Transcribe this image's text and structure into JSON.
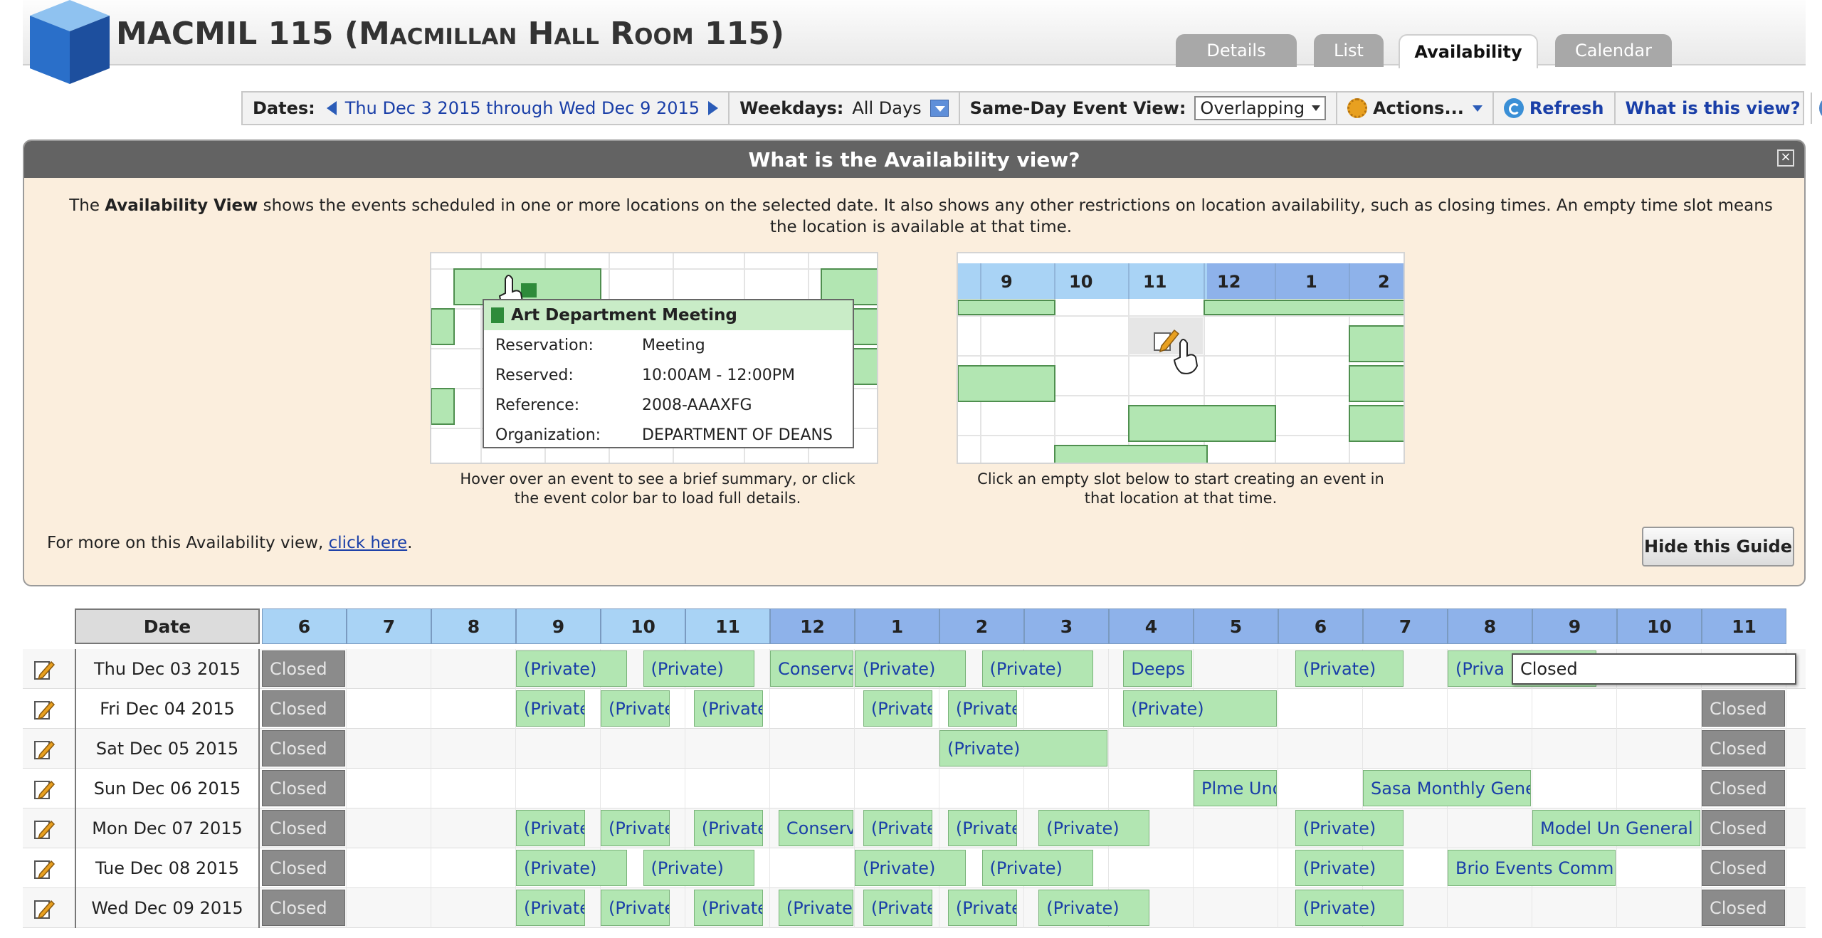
{
  "header": {
    "room_code": "MACMIL 115",
    "room_name": "(Macmillan Hall Room 115)",
    "tabs": [
      {
        "label": "Details",
        "active": false
      },
      {
        "label": "List",
        "active": false
      },
      {
        "label": "Availability",
        "active": true
      },
      {
        "label": "Calendar",
        "active": false
      }
    ]
  },
  "toolbar": {
    "dates_label": "Dates:",
    "date_range": "Thu Dec 3 2015 through Wed Dec 9 2015",
    "weekdays_label": "Weekdays:",
    "weekdays_value": "All Days",
    "same_day_label": "Same-Day Event View:",
    "same_day_value": "Overlapping",
    "actions_label": "Actions...",
    "refresh_label": "Refresh",
    "what_is_label": "What is this view?",
    "help_glyph": "?"
  },
  "guide": {
    "title": "What is the Availability view?",
    "close_glyph": "×",
    "intro_pre": "The ",
    "intro_bold": "Availability View",
    "intro_post": " shows the events scheduled in one or more locations on the selected date. It also shows any other restrictions on location availability, such as closing times. An empty time slot means the location is available at that time.",
    "example1": {
      "popup_title": "Art Department Meeting",
      "rows": [
        {
          "key": "Reservation:",
          "value": "Meeting"
        },
        {
          "key": "Reserved:",
          "value": "10:00AM - 12:00PM"
        },
        {
          "key": "Reference:",
          "value": "2008-AAAXFG"
        },
        {
          "key": "Organization:",
          "value": "DEPARTMENT OF DEANS"
        }
      ],
      "caption": "Hover over an event to see a brief summary, or click the event color bar to load full details."
    },
    "example2": {
      "hours": [
        "9",
        "10",
        "11",
        "12",
        "1",
        "2"
      ],
      "caption": "Click an empty slot below to start creating an event in that location at that time."
    },
    "more_pre": "For more on this Availability view, ",
    "more_link": "click here",
    "more_post": ".",
    "hide_button": "Hide this Guide"
  },
  "grid": {
    "date_header": "Date",
    "hours": [
      "6",
      "7",
      "8",
      "9",
      "10",
      "11",
      "12",
      "1",
      "2",
      "3",
      "4",
      "5",
      "6",
      "7",
      "8",
      "9",
      "10",
      "11"
    ],
    "pm_start_index": 6,
    "rows": [
      {
        "date": "Thu Dec 03 2015",
        "events": [
          {
            "label": "Closed",
            "type": "closed",
            "start": 6,
            "end": 7
          },
          {
            "label": "(Private)",
            "type": "event",
            "start": 9,
            "end": 10.33
          },
          {
            "label": "(Private)",
            "type": "event",
            "start": 10.5,
            "end": 11.83
          },
          {
            "label": "Conservat",
            "type": "event",
            "start": 12,
            "end": 13
          },
          {
            "label": "(Private)",
            "type": "event",
            "start": 13,
            "end": 14.33
          },
          {
            "label": "(Private)",
            "type": "event",
            "start": 14.5,
            "end": 15.83
          },
          {
            "label": "Deeps C",
            "type": "event",
            "start": 16.17,
            "end": 17
          },
          {
            "label": "(Private)",
            "type": "event",
            "start": 18.2,
            "end": 19.5
          },
          {
            "label": "(Priva",
            "type": "event",
            "start": 20,
            "end": 21.77
          }
        ]
      },
      {
        "date": "Fri Dec 04 2015",
        "events": [
          {
            "label": "Closed",
            "type": "closed",
            "start": 6,
            "end": 7
          },
          {
            "label": "(Private",
            "type": "event",
            "start": 9,
            "end": 9.83
          },
          {
            "label": "(Private",
            "type": "event",
            "start": 10,
            "end": 10.83
          },
          {
            "label": "(Private",
            "type": "event",
            "start": 11.1,
            "end": 11.93
          },
          {
            "label": "(Private",
            "type": "event",
            "start": 13.1,
            "end": 13.93
          },
          {
            "label": "(Private",
            "type": "event",
            "start": 14.1,
            "end": 14.93
          },
          {
            "label": "(Private)",
            "type": "event",
            "start": 16.17,
            "end": 18
          },
          {
            "label": "Closed",
            "type": "closed",
            "start": 23,
            "end": 24
          }
        ]
      },
      {
        "date": "Sat Dec 05 2015",
        "events": [
          {
            "label": "Closed",
            "type": "closed",
            "start": 6,
            "end": 7
          },
          {
            "label": "(Private)",
            "type": "event",
            "start": 14,
            "end": 16
          },
          {
            "label": "Closed",
            "type": "closed",
            "start": 23,
            "end": 24
          }
        ]
      },
      {
        "date": "Sun Dec 06 2015",
        "events": [
          {
            "label": "Closed",
            "type": "closed",
            "start": 6,
            "end": 7
          },
          {
            "label": "Plme Und",
            "type": "event",
            "start": 17,
            "end": 18
          },
          {
            "label": "Sasa Monthly Genera",
            "type": "event",
            "start": 19,
            "end": 21
          },
          {
            "label": "Closed",
            "type": "closed",
            "start": 23,
            "end": 24
          }
        ]
      },
      {
        "date": "Mon Dec 07 2015",
        "events": [
          {
            "label": "Closed",
            "type": "closed",
            "start": 6,
            "end": 7
          },
          {
            "label": "(Private",
            "type": "event",
            "start": 9,
            "end": 9.83
          },
          {
            "label": "(Private",
            "type": "event",
            "start": 10,
            "end": 10.83
          },
          {
            "label": "(Private",
            "type": "event",
            "start": 11.1,
            "end": 11.93
          },
          {
            "label": "Conservat",
            "type": "event",
            "start": 12.1,
            "end": 13
          },
          {
            "label": "(Private",
            "type": "event",
            "start": 13.1,
            "end": 13.93
          },
          {
            "label": "(Private",
            "type": "event",
            "start": 14.1,
            "end": 14.93
          },
          {
            "label": "(Private)",
            "type": "event",
            "start": 15.17,
            "end": 16.5
          },
          {
            "label": "(Private)",
            "type": "event",
            "start": 18.2,
            "end": 19.5
          },
          {
            "label": "Model Un General Bo",
            "type": "event",
            "start": 21,
            "end": 23
          },
          {
            "label": "Closed",
            "type": "closed",
            "start": 23,
            "end": 24
          }
        ]
      },
      {
        "date": "Tue Dec 08 2015",
        "events": [
          {
            "label": "Closed",
            "type": "closed",
            "start": 6,
            "end": 7
          },
          {
            "label": "(Private)",
            "type": "event",
            "start": 9,
            "end": 10.33
          },
          {
            "label": "(Private)",
            "type": "event",
            "start": 10.5,
            "end": 11.83
          },
          {
            "label": "(Private)",
            "type": "event",
            "start": 13,
            "end": 14.33
          },
          {
            "label": "(Private)",
            "type": "event",
            "start": 14.5,
            "end": 15.83
          },
          {
            "label": "(Private)",
            "type": "event",
            "start": 18.2,
            "end": 19.5
          },
          {
            "label": "Brio Events Committ",
            "type": "event",
            "start": 20,
            "end": 22
          },
          {
            "label": "Closed",
            "type": "closed",
            "start": 23,
            "end": 24
          }
        ]
      },
      {
        "date": "Wed Dec 09 2015",
        "events": [
          {
            "label": "Closed",
            "type": "closed",
            "start": 6,
            "end": 7
          },
          {
            "label": "(Private",
            "type": "event",
            "start": 9,
            "end": 9.83
          },
          {
            "label": "(Private",
            "type": "event",
            "start": 10,
            "end": 10.83
          },
          {
            "label": "(Private",
            "type": "event",
            "start": 11.1,
            "end": 11.93
          },
          {
            "label": "(Private",
            "type": "event",
            "start": 12.1,
            "end": 13
          },
          {
            "label": "(Private",
            "type": "event",
            "start": 13.1,
            "end": 13.93
          },
          {
            "label": "(Private",
            "type": "event",
            "start": 14.1,
            "end": 14.93
          },
          {
            "label": "(Private)",
            "type": "event",
            "start": 15.17,
            "end": 16.5
          },
          {
            "label": "(Private)",
            "type": "event",
            "start": 18.2,
            "end": 19.5
          },
          {
            "label": "Closed",
            "type": "closed",
            "start": 23,
            "end": 24
          }
        ]
      }
    ],
    "tooltip": "Closed"
  },
  "colors": {
    "event_fill": "#b2e6b2",
    "closed_fill": "#8b8b8b",
    "am_header": "#a9d3f5",
    "pm_header": "#8eb2ea",
    "guide_bg": "#fbeedd",
    "link": "#1a3fa8"
  }
}
